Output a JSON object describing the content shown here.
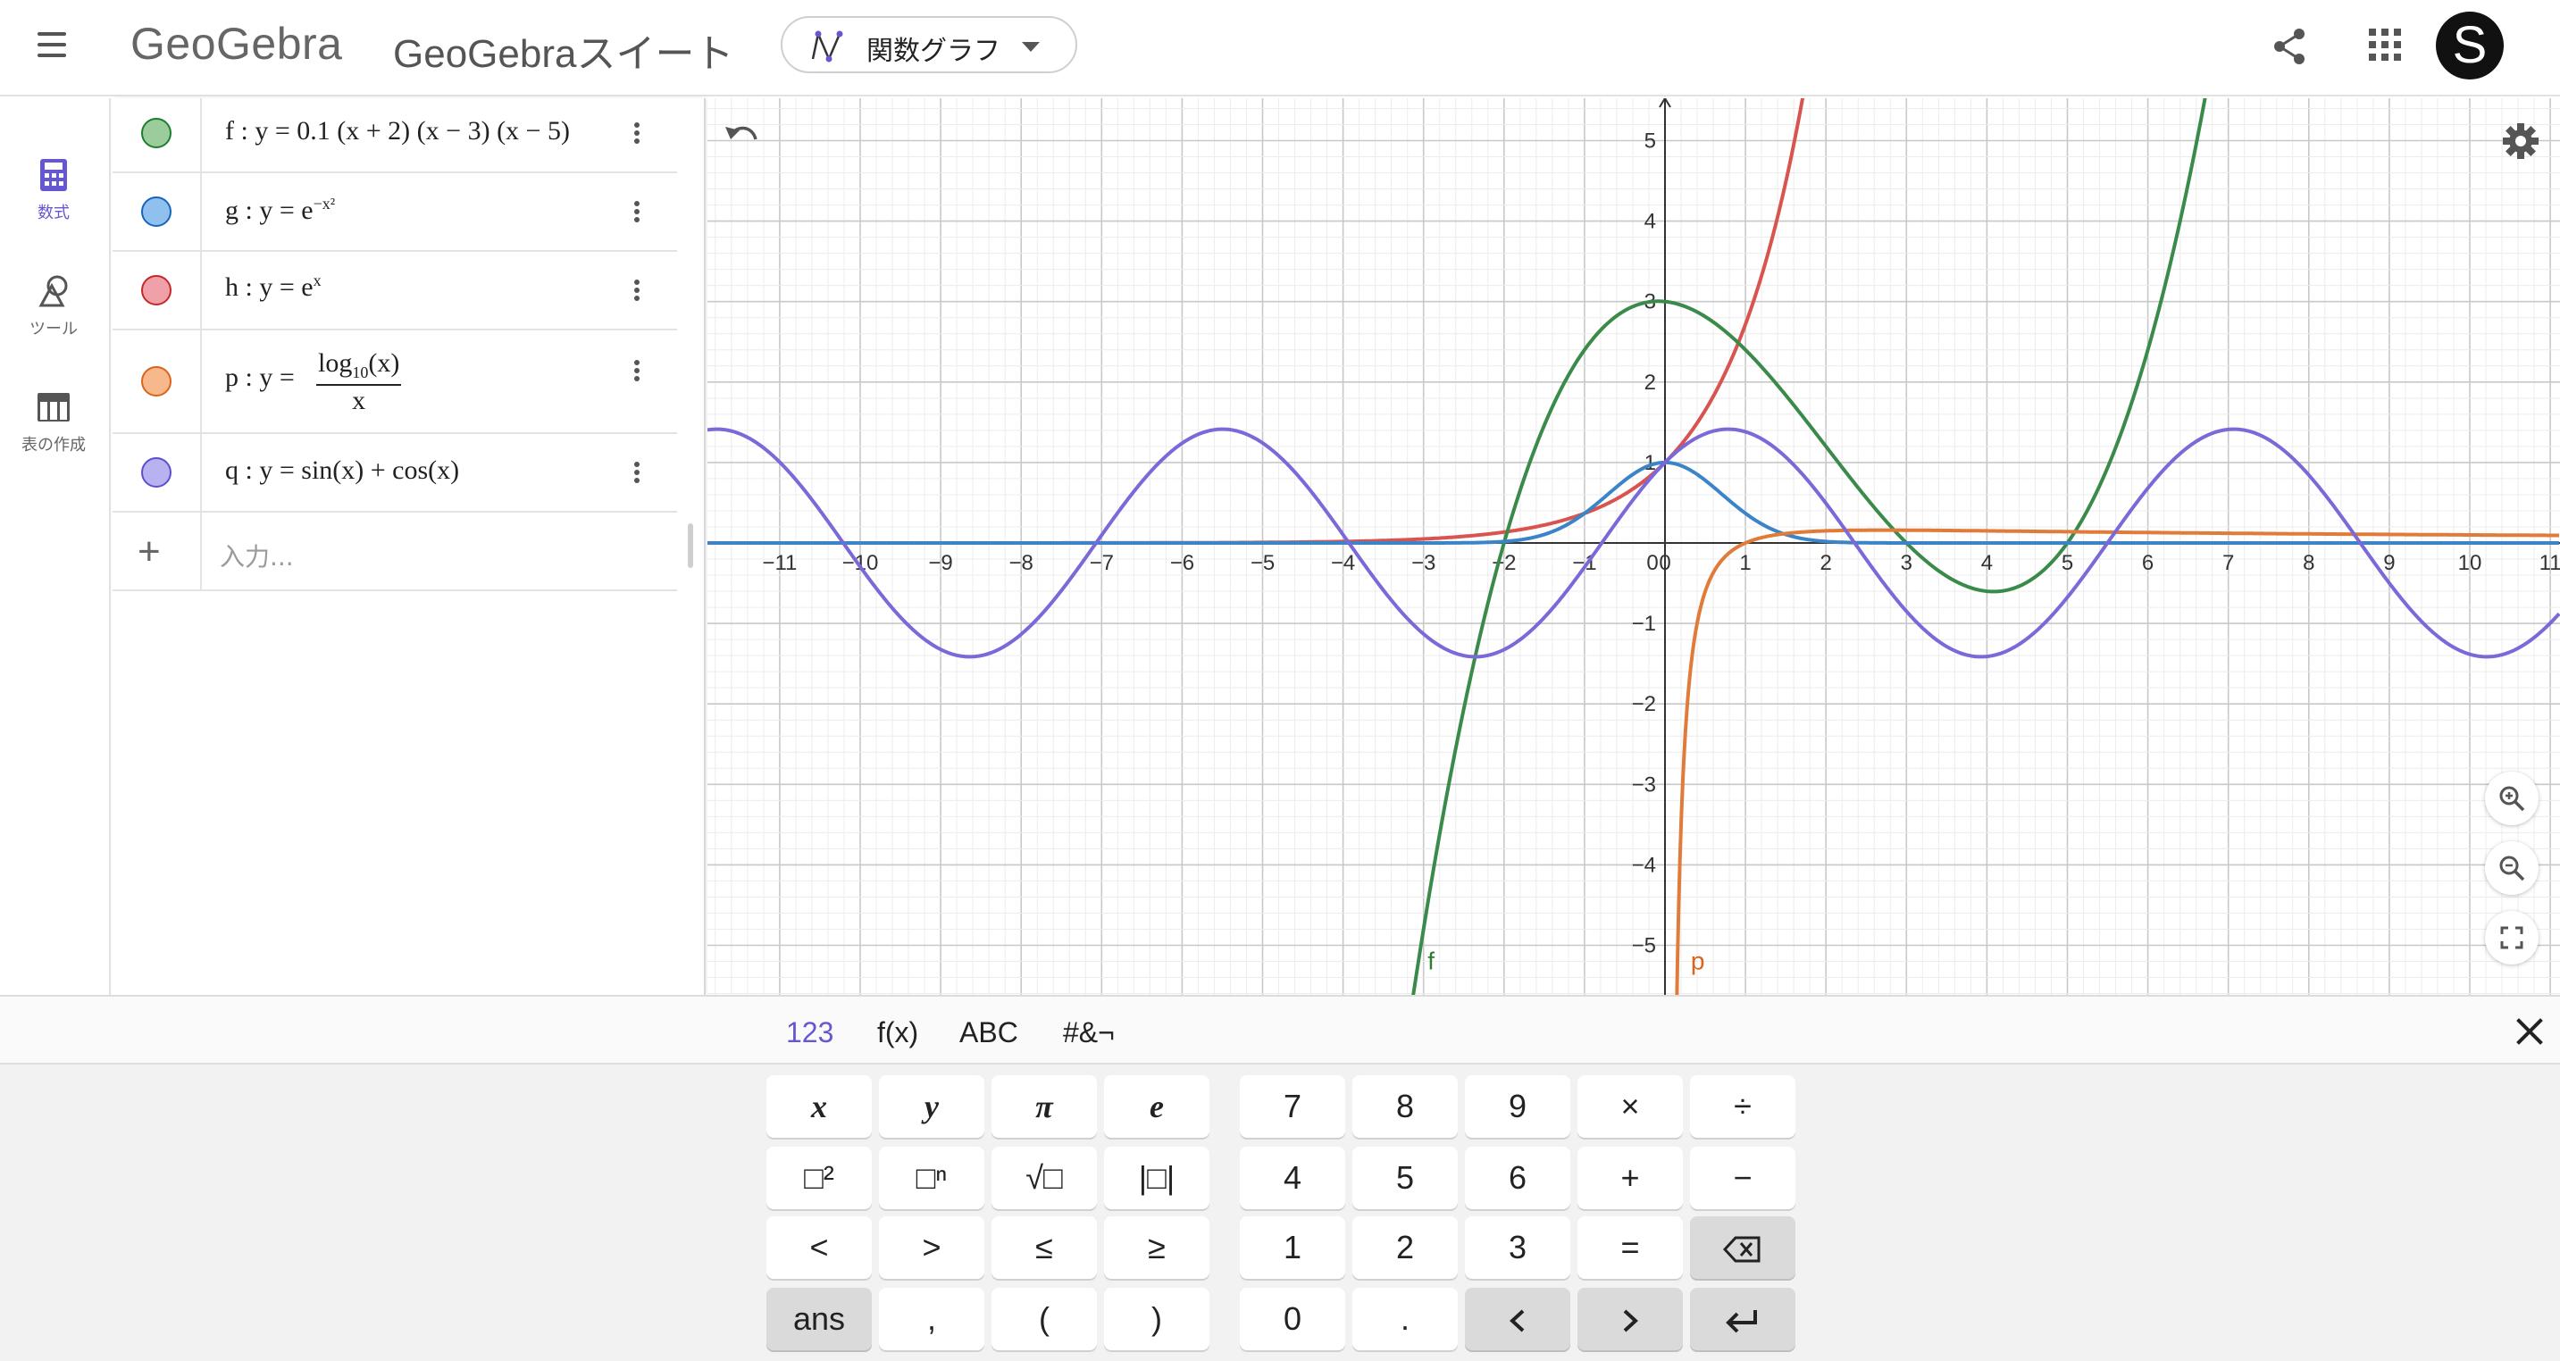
{
  "header": {
    "logo": "GeoGebra",
    "app_title": "GeoGebraスイート",
    "app_switcher": {
      "label": "関数グラフ"
    },
    "avatar_letter": "S"
  },
  "rail": {
    "items": [
      {
        "label": "数式",
        "icon": "calculator-icon",
        "active": true
      },
      {
        "label": "ツール",
        "icon": "tools-icon",
        "active": false
      },
      {
        "label": "表の作成",
        "icon": "table-icon",
        "active": false
      }
    ]
  },
  "algebra": {
    "rows": [
      {
        "name": "f",
        "color": "#1a7f2e",
        "fill": "#9ccc9c"
      },
      {
        "name": "g",
        "color": "#1565c0",
        "fill": "#90c0ee"
      },
      {
        "name": "h",
        "color": "#c62828",
        "fill": "#f0a0a8"
      },
      {
        "name": "p",
        "color": "#d9641c",
        "fill": "#f7b88c"
      },
      {
        "name": "q",
        "color": "#5b4fcf",
        "fill": "#b8b2f0"
      }
    ],
    "f_expr": {
      "name": "f",
      "sep": ":",
      "lhs": "y",
      "eq": "=",
      "rhs": "0.1 (x + 2) (x − 3) (x − 5)"
    },
    "g_expr": {
      "name": "g",
      "sep": ":",
      "lhs": "y",
      "eq": "=",
      "base": "e",
      "exp": "−x²"
    },
    "h_expr": {
      "name": "h",
      "sep": ":",
      "lhs": "y",
      "eq": "=",
      "base": "e",
      "exp": "x"
    },
    "p_expr": {
      "name": "p",
      "sep": ":",
      "lhs": "y",
      "eq": "=",
      "num_fn": "log",
      "num_sub": "10",
      "num_arg": "(x)",
      "den": "x"
    },
    "q_expr": {
      "name": "q",
      "sep": ":",
      "lhs": "y",
      "eq": "=",
      "rhs": "sin(x) + cos(x)"
    },
    "input_placeholder": "入力...",
    "add_symbol": "+"
  },
  "graphics": {
    "curve_labels": [
      {
        "text": "f",
        "color": "#2e7d32"
      },
      {
        "text": "p",
        "color": "#d9641c"
      }
    ]
  },
  "chart_data": {
    "type": "line",
    "title": "",
    "xlabel": "",
    "ylabel": "",
    "xlim": [
      -11.9,
      11.2
    ],
    "ylim": [
      -5.6,
      5.5
    ],
    "x_ticks": [
      -11,
      -10,
      -9,
      -8,
      -7,
      -6,
      -5,
      -4,
      -3,
      -2,
      -1,
      0,
      1,
      2,
      3,
      4,
      5,
      6,
      7,
      8,
      9,
      10,
      11
    ],
    "y_ticks": [
      -5,
      -4,
      -3,
      -2,
      -1,
      1,
      2,
      3,
      4,
      5
    ],
    "grid": true,
    "series": [
      {
        "name": "f",
        "expression": "0.1 (x + 2) (x − 3) (x − 5)",
        "color": "#3a8a4a"
      },
      {
        "name": "g",
        "expression": "e^(−x²)",
        "color": "#3b84c8"
      },
      {
        "name": "h",
        "expression": "e^x",
        "color": "#d9534f"
      },
      {
        "name": "p",
        "expression": "log10(x) / x",
        "color": "#e07b39"
      },
      {
        "name": "q",
        "expression": "sin(x) + cos(x)",
        "color": "#7b68d9"
      }
    ]
  },
  "keyboard": {
    "tabs": [
      "123",
      "f(x)",
      "ABC",
      "#&¬"
    ],
    "active_tab": "123",
    "left_keys": [
      [
        "x",
        "y",
        "π",
        "e"
      ],
      [
        "□²",
        "□ⁿ",
        "√□",
        "|□|"
      ],
      [
        "<",
        ">",
        "≤",
        "≥"
      ],
      [
        "ans",
        ",",
        "(",
        ")"
      ]
    ],
    "right_keys": [
      [
        "7",
        "8",
        "9",
        "×",
        "÷"
      ],
      [
        "4",
        "5",
        "6",
        "+",
        "−"
      ],
      [
        "1",
        "2",
        "3",
        "=",
        "backspace"
      ],
      [
        "0",
        ".",
        "left",
        "right",
        "enter"
      ]
    ]
  }
}
